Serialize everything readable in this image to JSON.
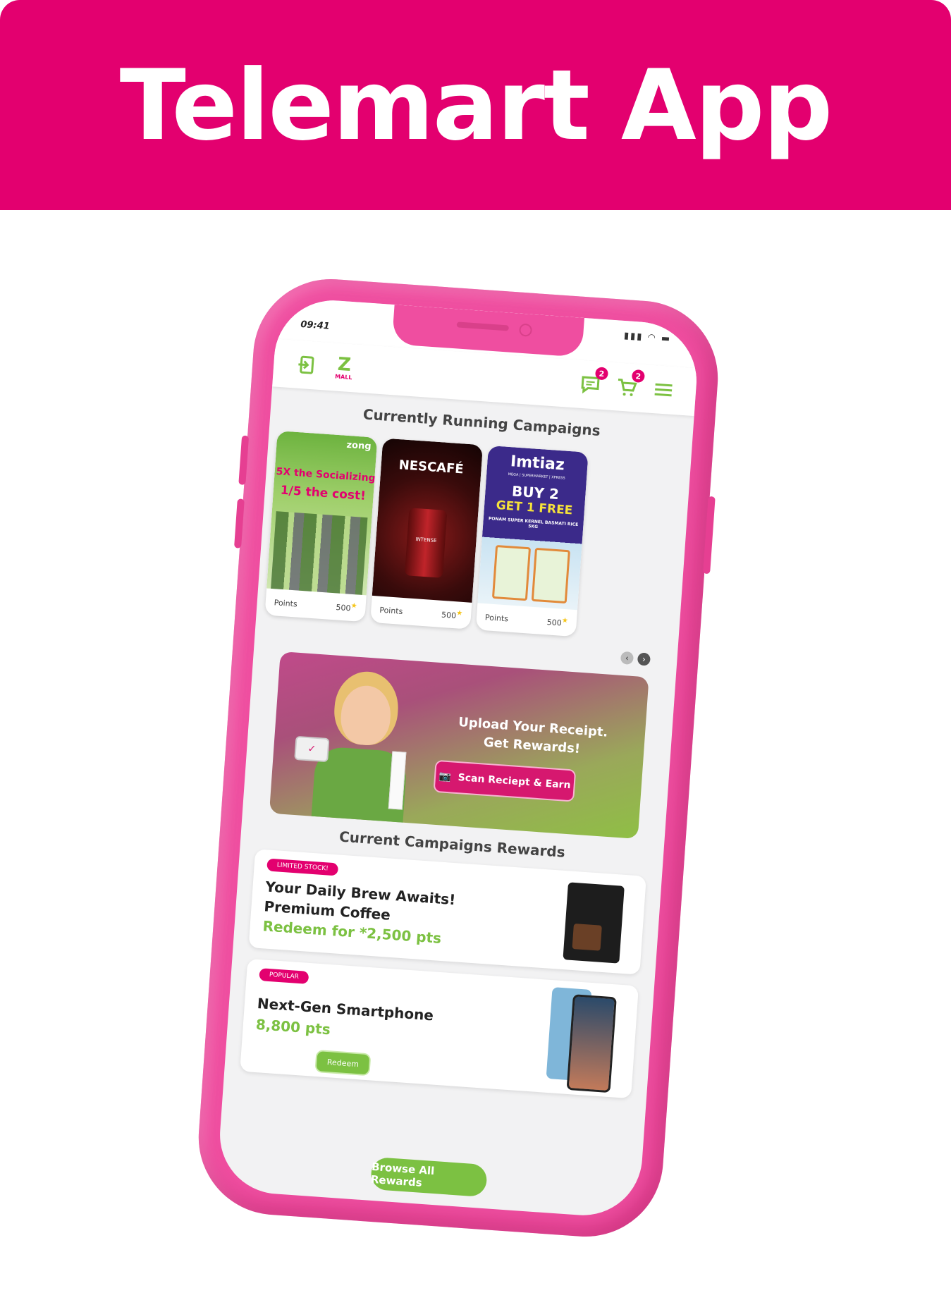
{
  "banner": {
    "title": "Telemart App"
  },
  "colors": {
    "brand": "#e3006f",
    "phone": "#ef4ea0",
    "accent_green": "#7cc142"
  },
  "status": {
    "time": "09:41",
    "icons": "signal wifi battery"
  },
  "appbar": {
    "messages_badge": "2",
    "cart_badge": "2",
    "logo_letter": "Z",
    "logo_sub": "MALL"
  },
  "campaigns": {
    "title": "Currently Running Campaigns",
    "cards": [
      {
        "brand": "zong",
        "headline1": "5X the Socializing",
        "headline2": "1/5 the cost!",
        "points_label": "Points",
        "points": "500"
      },
      {
        "brand": "NESCAFÉ",
        "subtitle": "INTENSE",
        "points_label": "Points",
        "points": "500"
      },
      {
        "brand": "Imtiaz",
        "tagline": "MEGA | SUPERMARKET | XPRESS",
        "headline1": "BUY 2",
        "headline2": "GET 1 FREE",
        "product": "PONAM SUPER KERNEL BASMATI RICE 5KG",
        "points_label": "Points",
        "points": "500"
      }
    ]
  },
  "promo": {
    "line1": "Upload Your Receipt.",
    "line2": "Get Rewards!",
    "button": "Scan Reciept & Earn"
  },
  "rewards": {
    "title": "Current Campaigns Rewards",
    "items": [
      {
        "tag": "LIMITED STOCK!",
        "title1": "Your Daily Brew Awaits!",
        "title2": "Premium Coffee",
        "points": "Redeem for *2,500 pts"
      },
      {
        "tag": "POPULAR",
        "title1": "Next-Gen Smartphone",
        "points": "8,800 pts",
        "button": "Redeem"
      }
    ],
    "browse": "Browse All Rewards"
  }
}
